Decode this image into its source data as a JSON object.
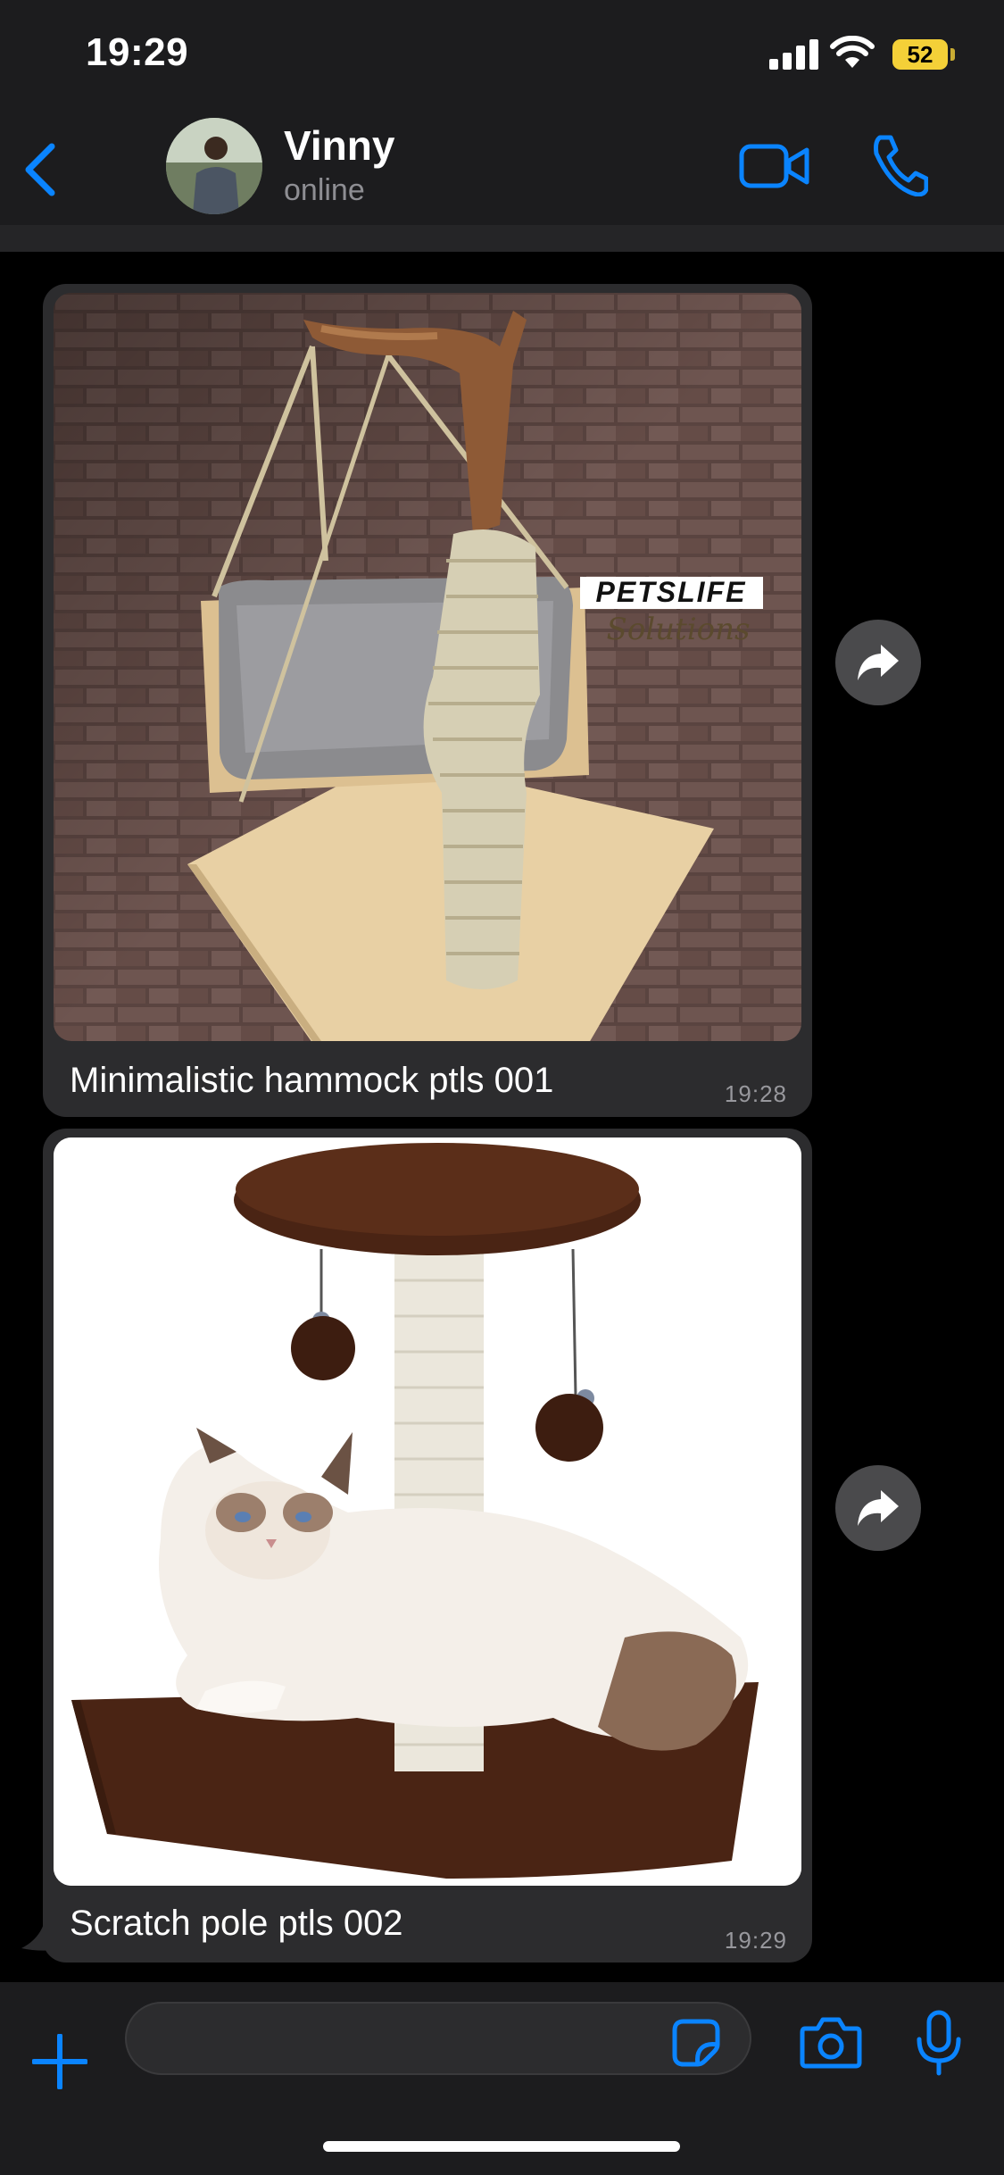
{
  "status_bar": {
    "time": "19:29",
    "battery_level": "52",
    "icons": [
      "signal-icon",
      "wifi-icon",
      "battery-icon"
    ]
  },
  "header": {
    "contact_name": "Vinny",
    "contact_status": "online",
    "icons": [
      "back-chevron-icon",
      "video-call-icon",
      "phone-icon"
    ]
  },
  "messages": [
    {
      "caption": "Minimalistic hammock ptls 001",
      "time": "19:28",
      "image_watermark": "PETSLIFE Solutions",
      "image_subject": "wooden cat hammock with sisal rope scratching post"
    },
    {
      "caption": "Scratch pole ptls 002",
      "time": "19:29",
      "image_subject": "cat scratching pole with brown platform and hanging pom-pom toys"
    }
  ],
  "input_bar": {
    "value": "",
    "placeholder": "",
    "icons": [
      "plus-icon",
      "sticker-icon",
      "camera-icon",
      "microphone-icon"
    ]
  },
  "colors": {
    "accent": "#0a84ff",
    "background": "#000000",
    "bar_background": "#1c1c1e",
    "bubble_background": "#2c2c2e",
    "battery": "#f4d038"
  }
}
